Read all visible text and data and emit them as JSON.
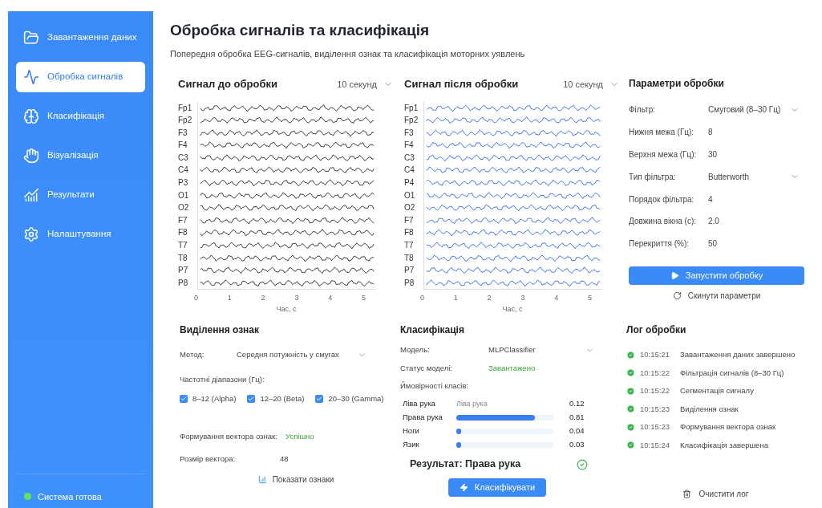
{
  "sidebar": {
    "items": [
      {
        "label": "Завантаження даних",
        "selected": false
      },
      {
        "label": "Обробка сигналів",
        "selected": true
      },
      {
        "label": "Класифікація",
        "selected": false
      },
      {
        "label": "Візуалізація",
        "selected": false
      },
      {
        "label": "Результати",
        "selected": false
      },
      {
        "label": "Налаштування",
        "selected": false
      }
    ],
    "status": {
      "label": "Система готова",
      "color": "#5ee65a"
    }
  },
  "header": {
    "title": "Обробка сигналів та класифікація",
    "subtitle": "Попередня обробка EEG-сигналів, виділення ознак та класифікація моторних уявлень"
  },
  "signal_panels": [
    {
      "title": "Сигнал до обробки",
      "range": "10 секунд",
      "kind": "raw",
      "channels": [
        "Fp1",
        "Fp2",
        "F3",
        "F4",
        "C3",
        "C4",
        "P3",
        "O1",
        "O2",
        "F7",
        "F8",
        "T7",
        "T8",
        "P7",
        "P8"
      ],
      "x_ticks": [
        "0",
        "1",
        "2",
        "3",
        "4",
        "5"
      ],
      "x_label": "Час, с"
    },
    {
      "title": "Сигнал після обробки",
      "range": "10 секунд",
      "kind": "filtered",
      "channels": [
        "Fp1",
        "Fp2",
        "F3",
        "F4",
        "C3",
        "C4",
        "P4",
        "O1",
        "O2",
        "F7",
        "F8",
        "T7",
        "T8",
        "P7",
        "P8"
      ],
      "x_ticks": [
        "0",
        "1",
        "2",
        "3",
        "4",
        "5"
      ],
      "x_label": "Час, с"
    }
  ],
  "parameters": {
    "title": "Параметри обробки",
    "fields": [
      {
        "label": "Фільтр:",
        "value": "Смуговий (8–30 Гц)",
        "kind": "select"
      },
      {
        "label": "Нижня межа (Гц):",
        "value": "8",
        "kind": "text"
      },
      {
        "label": "Верхня межа (Гц):",
        "value": "30",
        "kind": "text"
      },
      {
        "label": "Тип фільтра:",
        "value": "Butterworth",
        "kind": "select"
      },
      {
        "label": "Порядок фільтра:",
        "value": "4",
        "kind": "text"
      },
      {
        "label": "Довжина вікна (с):",
        "value": "2.0",
        "kind": "text"
      },
      {
        "label": "Перекриття (%):",
        "value": "50",
        "kind": "text"
      }
    ],
    "run_button": "Запустити обробку",
    "reset_button": "Скинути параметри"
  },
  "features": {
    "title": "Виділення ознак",
    "method_label": "Метод:",
    "method_value": "Середня потужність у смугах",
    "bands_label": "Частотні діапазони (Гц):",
    "bands": [
      {
        "label": "8–12 (Alpha)",
        "checked": true
      },
      {
        "label": "12–20 (Beta)",
        "checked": true
      },
      {
        "label": "20–30 (Gamma)",
        "checked": true
      }
    ],
    "vector_label": "Формування вектора ознак:",
    "vector_status": "Успішно",
    "size_label": "Розмір вектора:",
    "size_value": "48",
    "show_button": "Показати ознаки"
  },
  "classification": {
    "title": "Класифікація",
    "model_label": "Модель:",
    "model_value": "MLPClassifier",
    "status_label": "Статус моделі:",
    "status_value": "Завантажено",
    "probs_label": "Ймовірності класів:",
    "classes": [
      {
        "name": "Ліва рука",
        "kind": "text",
        "bar_text": "Ліва рука",
        "value": "0.12"
      },
      {
        "name": "Права рука",
        "kind": "bar",
        "level": 0.81,
        "value": "0.81"
      },
      {
        "name": "Ноги",
        "kind": "bar",
        "level": 0.04,
        "value": "0.04"
      },
      {
        "name": "Язик",
        "kind": "bar",
        "level": 0.03,
        "value": "0.03"
      }
    ],
    "result": "Результат: Права рука",
    "classify_button": "Класифікувати"
  },
  "log": {
    "title": "Лог обробки",
    "entries": [
      {
        "time": "10:15:21",
        "message": "Завантаження даних завершено"
      },
      {
        "time": "10:15:22",
        "message": "Фільтрація сигналів (8–30 Гц)"
      },
      {
        "time": "10:15:22",
        "message": "Сегментація сигналу"
      },
      {
        "time": "10:15:23",
        "message": "Виділення ознак"
      },
      {
        "time": "10:15:23",
        "message": "Формування вектора ознак"
      },
      {
        "time": "10:15:24",
        "message": "Класифікація завершена"
      }
    ],
    "clear_button": "Очистити лог"
  }
}
